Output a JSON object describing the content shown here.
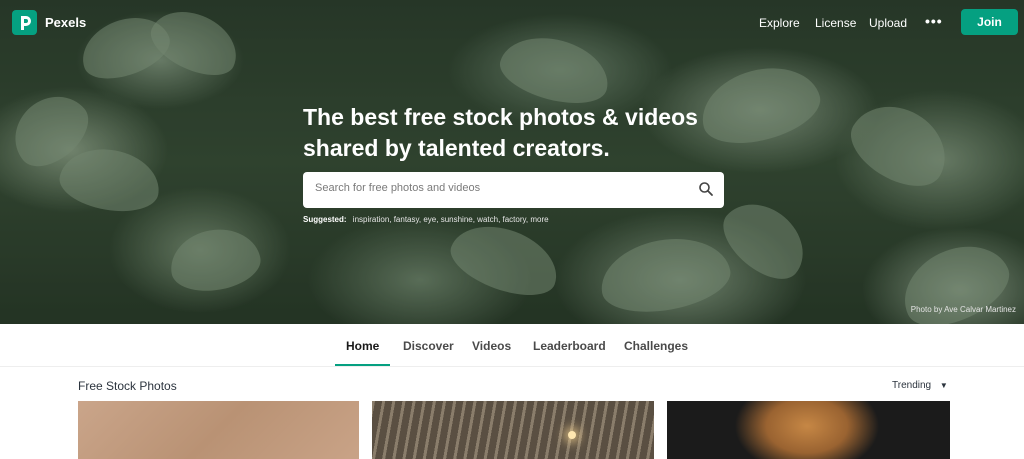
{
  "brand": {
    "name": "Pexels",
    "accent": "#05a081"
  },
  "nav": {
    "links": [
      "Explore",
      "License",
      "Upload"
    ],
    "more_icon": "more-dots-icon",
    "join_label": "Join"
  },
  "hero": {
    "headline": "The best free stock photos & videos shared by talented creators.",
    "search_placeholder": "Search for free photos and videos",
    "suggested_label": "Suggested:",
    "suggestions": "inspiration, fantasy, eye, sunshine, watch, factory, more",
    "credit": "Photo by Ave Calvar Martinez"
  },
  "tabs": [
    "Home",
    "Discover",
    "Videos",
    "Leaderboard",
    "Challenges"
  ],
  "active_tab": "Home",
  "main": {
    "section_title": "Free Stock Photos",
    "sort_label": "Trending"
  }
}
